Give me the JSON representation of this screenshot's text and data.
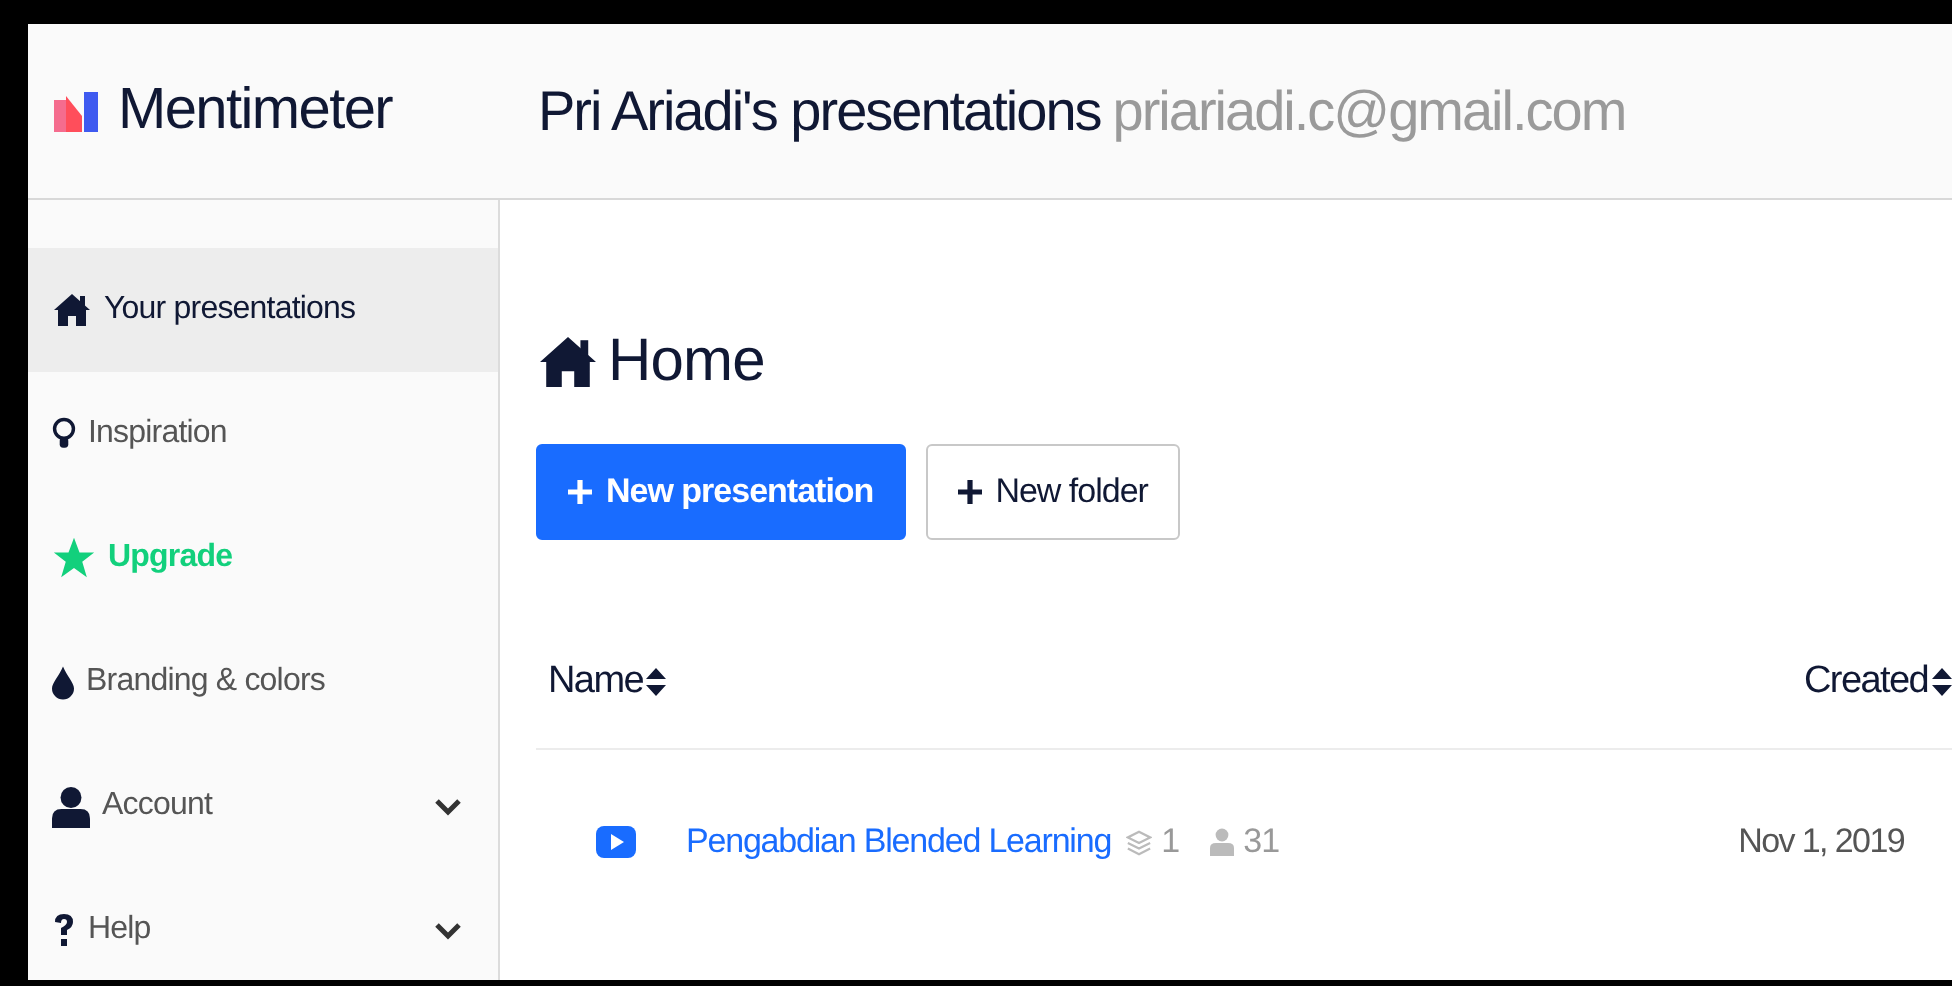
{
  "app": {
    "logo": "Mentimeter"
  },
  "header": {
    "title": "Pri Ariadi's presentations",
    "email": "priariadi.c@gmail.com"
  },
  "sidebar": {
    "items": [
      {
        "label": "Your presentations",
        "kind": "home",
        "selected": true,
        "accent": false,
        "expandable": false
      },
      {
        "label": "Inspiration",
        "kind": "bulb",
        "selected": false,
        "accent": false,
        "expandable": false
      },
      {
        "label": "Upgrade",
        "kind": "star",
        "selected": false,
        "accent": true,
        "expandable": false
      },
      {
        "label": "Branding & colors",
        "kind": "drop",
        "selected": false,
        "accent": false,
        "expandable": false
      },
      {
        "label": "Account",
        "kind": "user",
        "selected": false,
        "accent": false,
        "expandable": true
      },
      {
        "label": "Help",
        "kind": "question",
        "selected": false,
        "accent": false,
        "expandable": true
      }
    ]
  },
  "main": {
    "heading": "Home",
    "buttons": [
      {
        "label": "New presentation",
        "kind": "primary"
      },
      {
        "label": "New folder",
        "kind": "secondary"
      }
    ],
    "table": {
      "columns": [
        "Name",
        "Created"
      ],
      "rows": [
        {
          "title": "Pengabdian Blended Learning",
          "slides": "1",
          "participants": "31",
          "created": "Nov 1, 2019"
        }
      ]
    }
  }
}
